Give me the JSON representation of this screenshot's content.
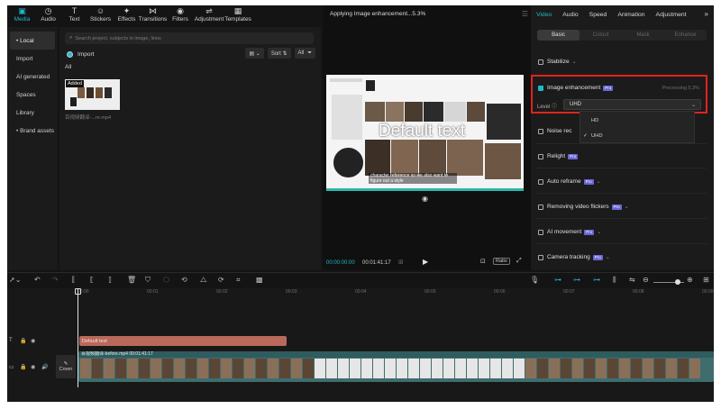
{
  "toolbar": {
    "items": [
      {
        "label": "Media",
        "icon": "media-icon",
        "glyph": "▣",
        "active": true
      },
      {
        "label": "Audio",
        "icon": "audio-icon",
        "glyph": "◷"
      },
      {
        "label": "Text",
        "icon": "text-icon",
        "glyph": "T"
      },
      {
        "label": "Stickers",
        "icon": "stickers-icon",
        "glyph": "☺"
      },
      {
        "label": "Effects",
        "icon": "effects-icon",
        "glyph": "✦"
      },
      {
        "label": "Transitions",
        "icon": "transitions-icon",
        "glyph": "⋈"
      },
      {
        "label": "Filters",
        "icon": "filters-icon",
        "glyph": "◉"
      },
      {
        "label": "Adjustment",
        "icon": "adjustment-icon",
        "glyph": "⇌"
      },
      {
        "label": "Templates",
        "icon": "templates-icon",
        "glyph": "▦"
      }
    ]
  },
  "sidebar": {
    "items": [
      {
        "label": "• Local",
        "active": true
      },
      {
        "label": "Import"
      },
      {
        "label": "AI generated"
      },
      {
        "label": "Spaces"
      },
      {
        "label": "Library"
      },
      {
        "label": "• Brand assets"
      }
    ]
  },
  "media": {
    "search_placeholder": "Search project, subjects in image, lines",
    "import_label": "Import",
    "view_label": "▤ ⌄",
    "sort_label": "Sort ⇅",
    "all_filter_label": "All",
    "filter_icon": "filter-icon",
    "filter_glyph": "⏷",
    "all_label": "All",
    "thumb_badge": "Added",
    "thumb_name": "百视频翻译-...re.mp4"
  },
  "player": {
    "title": "Applying Image enhancement...5.3%",
    "menu_glyph": "☰",
    "overlay_text": "Default text",
    "subtitle_text": "character reference so we also want to figure out a style",
    "time_current": "00:00:00:00",
    "time_total": "00:01:41:17",
    "ratio_label": "Ratio",
    "play_glyph": "▶",
    "snap_glyph": "◉",
    "grid_glyph": "⊞",
    "fit_glyph": "⊡",
    "full_glyph": "⤢"
  },
  "props": {
    "tabs": [
      {
        "label": "Video",
        "active": true
      },
      {
        "label": "Audio"
      },
      {
        "label": "Speed"
      },
      {
        "label": "Animation"
      },
      {
        "label": "Adjustment"
      }
    ],
    "more_glyph": "»",
    "subtabs": [
      {
        "label": "Basic",
        "active": true
      },
      {
        "label": "Cutout"
      },
      {
        "label": "Mask"
      },
      {
        "label": "Enhance"
      }
    ],
    "stabilize": "Stabilize",
    "image_enhancement": "Image enhancement",
    "pro_badge": "Pro",
    "processing": "Processing 5.3%",
    "level_label": "Level ⓘ",
    "level_value": "UHD",
    "dropdown_options": [
      {
        "label": "HD",
        "selected": false
      },
      {
        "label": "UHD",
        "selected": true
      }
    ],
    "noise_reduction": "Noise rec",
    "relight": "Relight",
    "auto_reframe": "Auto reframe",
    "removing_flickers": "Removing video flickers",
    "ai_movement": "AI movement",
    "camera_tracking": "Camera tracking",
    "accent": "#1fb8c7",
    "highlight_border": "#e0241c"
  },
  "timeline": {
    "ruler_marks": [
      "00:00",
      "00:01",
      "00:02",
      "00:03",
      "00:04",
      "00:05",
      "00:06",
      "00:07",
      "00:08",
      "00:09"
    ],
    "text_clip_label": "Default text",
    "video_clip_label": "百视频翻译-before.mp4  00:01:41:17",
    "cover_label": "Cover",
    "cover_glyph": "✎"
  }
}
